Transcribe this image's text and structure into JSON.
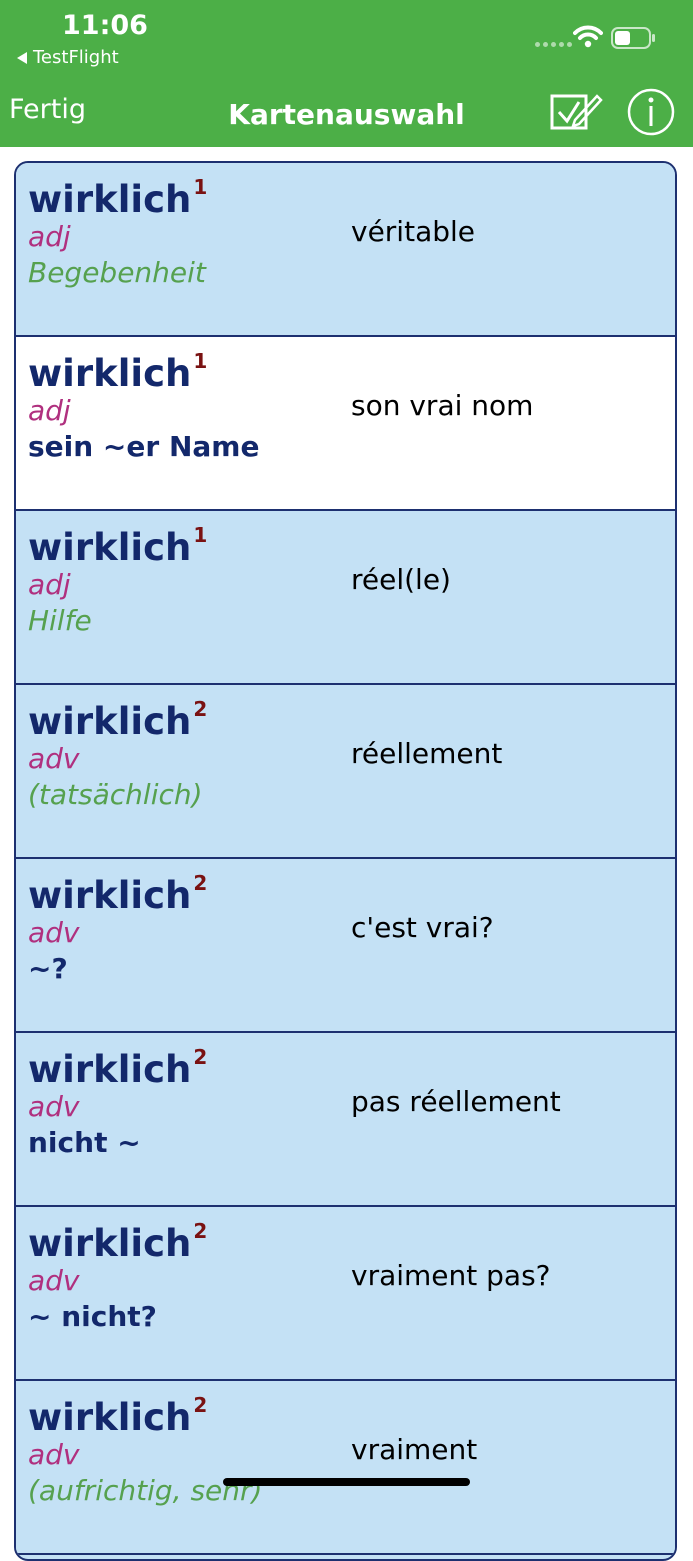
{
  "status": {
    "time": "11:06",
    "back_app": "TestFlight"
  },
  "nav": {
    "left_label": "Fertig",
    "title": "Kartenauswahl"
  },
  "cards": [
    {
      "word": "wirklich",
      "sense": "1",
      "pos": "adj",
      "example": "Begebenheit",
      "example_style": "context",
      "translation": "véritable",
      "bg": "blue"
    },
    {
      "word": "wirklich",
      "sense": "1",
      "pos": "adj",
      "example": "sein ~er Name",
      "example_style": "phrase",
      "translation": "son vrai nom",
      "bg": "white"
    },
    {
      "word": "wirklich",
      "sense": "1",
      "pos": "adj",
      "example": "Hilfe",
      "example_style": "context",
      "translation": "réel(le)",
      "bg": "blue"
    },
    {
      "word": "wirklich",
      "sense": "2",
      "pos": "adv",
      "example": "(tatsächlich)",
      "example_style": "context",
      "translation": "réellement",
      "bg": "blue"
    },
    {
      "word": "wirklich",
      "sense": "2",
      "pos": "adv",
      "example": "~?",
      "example_style": "phrase",
      "translation": "c'est vrai?",
      "bg": "blue"
    },
    {
      "word": "wirklich",
      "sense": "2",
      "pos": "adv",
      "example": "nicht ~",
      "example_style": "phrase",
      "translation": "pas réellement",
      "bg": "blue"
    },
    {
      "word": "wirklich",
      "sense": "2",
      "pos": "adv",
      "example": "~ nicht?",
      "example_style": "phrase",
      "translation": "vraiment pas?",
      "bg": "blue"
    },
    {
      "word": "wirklich",
      "sense": "2",
      "pos": "adv",
      "example": "(aufrichtig, sehr)",
      "example_style": "context",
      "translation": "vraiment",
      "bg": "blue"
    }
  ],
  "colors": {
    "header_bg": "#4caf47",
    "card_blue": "#c4e1f5",
    "headword": "#13286b",
    "sense_number": "#7a1212",
    "pos": "#b0307f",
    "context": "#56a14f",
    "border": "#1d3070"
  },
  "icons": {
    "back": "triangle-left-icon",
    "signal": "signal-dots-icon",
    "wifi": "wifi-icon",
    "battery": "battery-icon",
    "edit": "checkbox-pencil-icon",
    "info": "info-circle-icon"
  }
}
